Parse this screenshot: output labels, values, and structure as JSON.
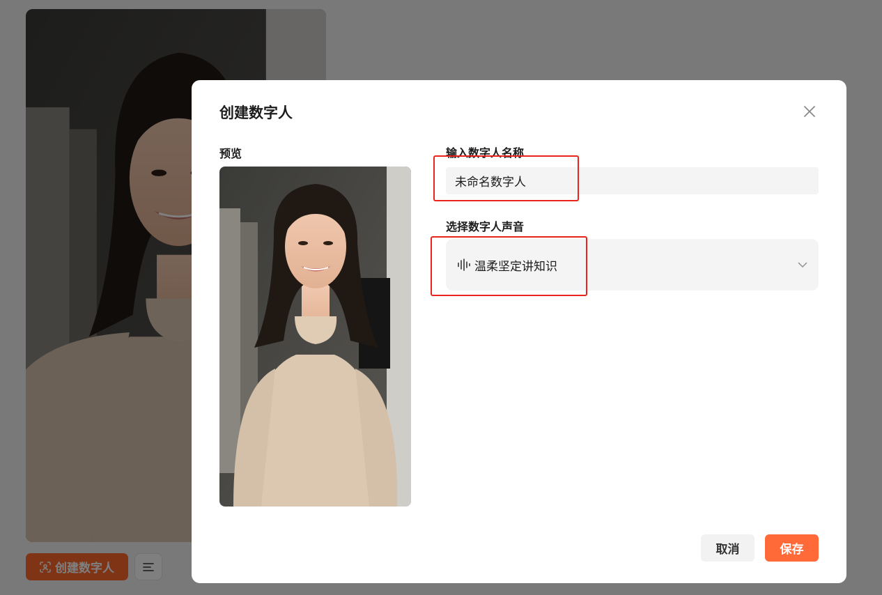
{
  "background": {
    "create_button_label": "创建数字人"
  },
  "modal": {
    "title": "创建数字人",
    "preview_label": "预览",
    "name_label": "输入数字人名称",
    "name_value": "未命名数字人",
    "voice_label": "选择数字人声音",
    "voice_value": "温柔坚定讲知识",
    "cancel_label": "取消",
    "save_label": "保存"
  },
  "icons": {
    "close": "close-icon",
    "voice": "sound-wave-icon",
    "dropdown": "chevron-down-icon",
    "menu": "menu-lines-icon",
    "face_scan": "face-scan-icon"
  },
  "colors": {
    "accent": "#ff6a38",
    "annotation": "#e8241c",
    "input_bg": "#f4f4f4"
  }
}
